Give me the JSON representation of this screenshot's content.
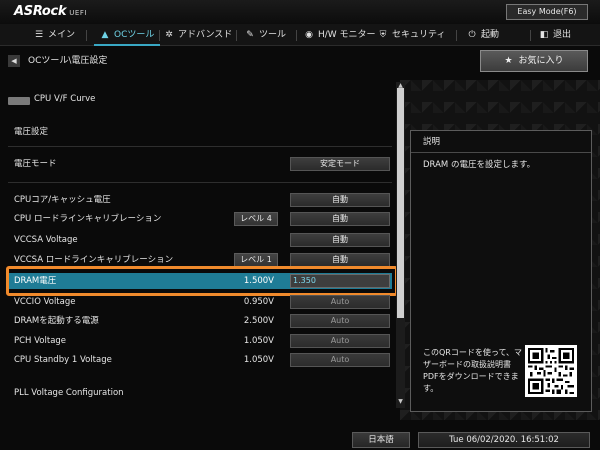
{
  "header": {
    "brand": "ASRock",
    "brand_sub": "UEFI",
    "mode_button": "Easy Mode(F6)"
  },
  "menu": {
    "items": [
      {
        "label": "メイン",
        "icon": "list-icon"
      },
      {
        "label": "OCツール",
        "icon": "rocket-icon",
        "active": true
      },
      {
        "label": "アドバンスド",
        "icon": "star-icon"
      },
      {
        "label": "ツール",
        "icon": "wrench-icon"
      },
      {
        "label": "H/W モニター",
        "icon": "monitor-icon"
      },
      {
        "label": "セキュリティ",
        "icon": "shield-icon"
      },
      {
        "label": "起動",
        "icon": "power-icon"
      },
      {
        "label": "退出",
        "icon": "exit-icon"
      }
    ]
  },
  "breadcrumb": "OCツール\\電圧設定",
  "favorite_button": "お気に入り",
  "settings": {
    "cpu_vf_curve": "CPU V/F Curve",
    "section_voltage": "電圧設定",
    "voltage_mode": {
      "label": "電圧モード",
      "value": "安定モード"
    },
    "rows": [
      {
        "label": "CPUコア/キャッシュ電圧",
        "value": "自動"
      },
      {
        "label": "CPU ロードラインキャリブレーション",
        "mid": "レベル 4",
        "value": "自動"
      },
      {
        "label": "VCCSA Voltage",
        "value": "自動"
      },
      {
        "label": "VCCSA ロードラインキャリブレーション",
        "mid": "レベル 1",
        "value": "自動"
      }
    ],
    "dram": {
      "label": "DRAM電圧",
      "current": "1.500V",
      "input": "1.350"
    },
    "rows2": [
      {
        "label": "VCCIO Voltage",
        "current": "0.950V",
        "value": "Auto"
      },
      {
        "label": "DRAMを起動する電源",
        "current": "2.500V",
        "value": "Auto"
      },
      {
        "label": "PCH Voltage",
        "current": "1.050V",
        "value": "Auto"
      },
      {
        "label": "CPU Standby 1 Voltage",
        "current": "1.050V",
        "value": "Auto"
      }
    ],
    "pll_config": "PLL Voltage Configuration"
  },
  "description": {
    "title": "説明",
    "text": "DRAM の電圧を設定します。",
    "qr_text": "このQRコードを使って、マザーボードの取扱説明書PDFをダウンロードできます。"
  },
  "footer": {
    "language": "日本語",
    "datetime": "Tue 06/02/2020. 16:51:02"
  },
  "colors": {
    "accent": "#1f7c96",
    "highlight_box": "#f08a2c",
    "active_tab": "#6fd3e6"
  }
}
